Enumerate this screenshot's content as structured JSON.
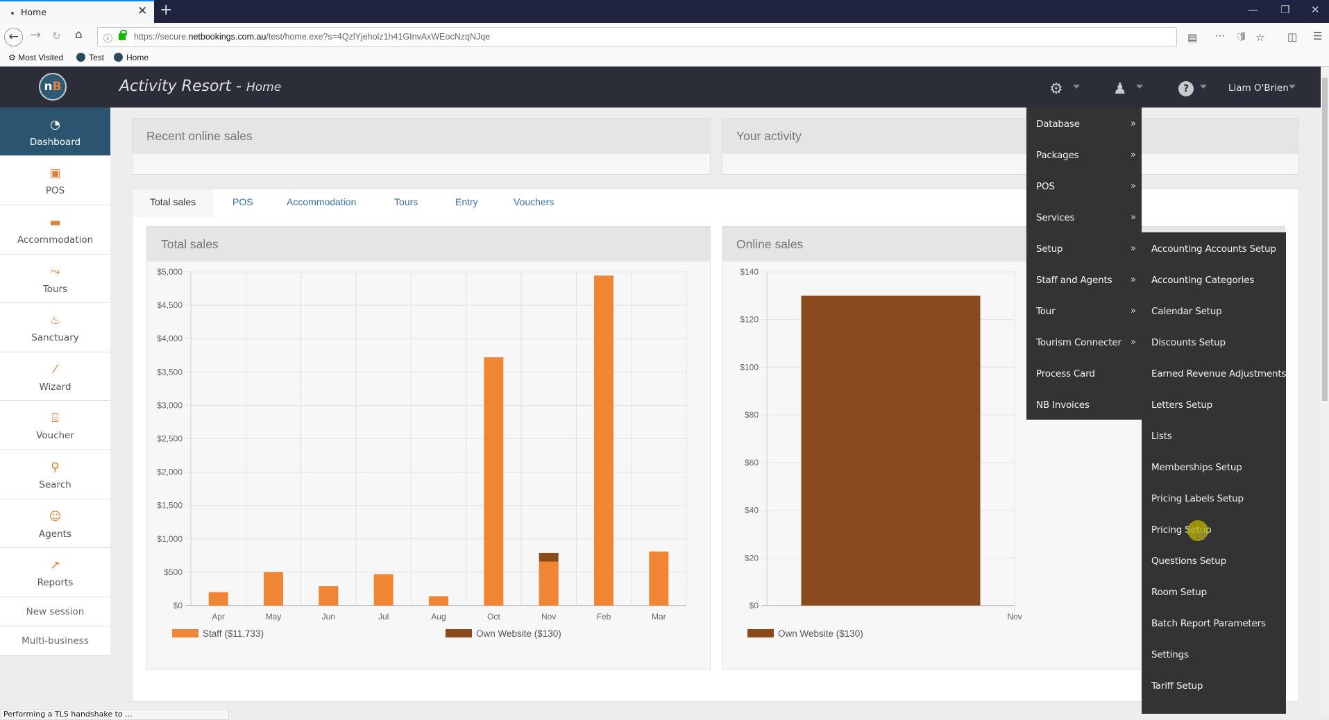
{
  "browser": {
    "tab_title": "Home",
    "url_prefix": "https://secure.",
    "url_domain": "netbookings.com.au",
    "url_path": "/test/home.exe?s=4QzlYjeholz1h41GInvAxWEocNzqNJqe",
    "bookmarks": [
      "Most Visited",
      "Test",
      "Home"
    ],
    "status_text": "Performing a TLS handshake to ..."
  },
  "header": {
    "app_name": "Activity Resort -",
    "page_name": "Home",
    "user_name": "Liam O'Brien",
    "logo_text": "n",
    "logo_accent": "B"
  },
  "sidebar": {
    "items": [
      {
        "label": "Dashboard",
        "icon": "dashboard-icon",
        "glyph": "◔"
      },
      {
        "label": "POS",
        "icon": "pos-icon",
        "glyph": "▣"
      },
      {
        "label": "Accommodation",
        "icon": "bed-icon",
        "glyph": "▬"
      },
      {
        "label": "Tours",
        "icon": "tours-icon",
        "glyph": "⤳"
      },
      {
        "label": "Sanctuary",
        "icon": "sanctuary-icon",
        "glyph": "♨"
      },
      {
        "label": "Wizard",
        "icon": "wand-icon",
        "glyph": "⁄"
      },
      {
        "label": "Voucher",
        "icon": "gift-icon",
        "glyph": "⌸"
      },
      {
        "label": "Search",
        "icon": "search-icon",
        "glyph": "⚲"
      },
      {
        "label": "Agents",
        "icon": "agent-icon",
        "glyph": "☺"
      },
      {
        "label": "Reports",
        "icon": "reports-icon",
        "glyph": "↗"
      }
    ],
    "plain_items": [
      "New session",
      "Multi-business"
    ]
  },
  "panels": {
    "recent_online_sales": "Recent online sales",
    "your_activity": "Your activity"
  },
  "tabs": [
    "Total sales",
    "POS",
    "Accommodation",
    "Tours",
    "Entry",
    "Vouchers"
  ],
  "colors": {
    "staff": "#f08533",
    "own_website": "#8b4a1e",
    "menu_bg": "#333333",
    "sidebar_active": "#2a5470"
  },
  "chart_data": [
    {
      "type": "bar",
      "title": "Total sales",
      "stacked": true,
      "categories": [
        "Apr",
        "May",
        "Jun",
        "Jul",
        "Aug",
        "Oct",
        "Nov",
        "Feb",
        "Mar"
      ],
      "series": [
        {
          "name": "Staff ($11,733)",
          "values": [
            200,
            500,
            290,
            470,
            140,
            3720,
            660,
            4945,
            808
          ]
        },
        {
          "name": "Own Website ($130)",
          "values": [
            0,
            0,
            0,
            0,
            0,
            0,
            130,
            0,
            0
          ]
        }
      ],
      "ylim": [
        0,
        5000
      ],
      "yticks": [
        0,
        500,
        1000,
        1500,
        2000,
        2500,
        3000,
        3500,
        4000,
        4500,
        5000
      ],
      "ytick_labels": [
        "$0",
        "$500",
        "$1,000",
        "$1,500",
        "$2,000",
        "$2,500",
        "$3,000",
        "$3,500",
        "$4,000",
        "$4,500",
        "$5,000"
      ],
      "xlabel": "",
      "ylabel": "",
      "grid": true,
      "legend": "bottom"
    },
    {
      "type": "bar",
      "title": "Online sales",
      "categories": [
        "Nov"
      ],
      "series": [
        {
          "name": "Own Website ($130)",
          "values": [
            130
          ]
        }
      ],
      "ylim": [
        0,
        140
      ],
      "yticks": [
        0,
        20,
        40,
        60,
        80,
        100,
        120,
        140
      ],
      "ytick_labels": [
        "$0",
        "$20",
        "$40",
        "$60",
        "$80",
        "$100",
        "$120",
        "$140"
      ],
      "xlabel": "",
      "ylabel": "",
      "grid": true,
      "legend": "bottom"
    }
  ],
  "menu": {
    "items": [
      {
        "label": "Database",
        "submenu": "»"
      },
      {
        "label": "Packages",
        "submenu": "»"
      },
      {
        "label": "POS",
        "submenu": "»"
      },
      {
        "label": "Services",
        "submenu": "»"
      },
      {
        "label": "Setup",
        "submenu": "»"
      },
      {
        "label": "Staff and Agents",
        "submenu": "»"
      },
      {
        "label": "Tour",
        "submenu": "»"
      },
      {
        "label": "Tourism Connecter",
        "submenu": "»"
      },
      {
        "label": "Process Card",
        "submenu": ""
      },
      {
        "label": "NB Invoices",
        "submenu": ""
      }
    ],
    "setup_submenu": [
      "Accounting Accounts Setup",
      "Accounting Categories",
      "Calendar Setup",
      "Discounts Setup",
      "Earned Revenue Adjustments",
      "Letters Setup",
      "Lists",
      "Memberships Setup",
      "Pricing Labels Setup",
      "Pricing Setup",
      "Questions Setup",
      "Room Setup",
      "Batch Report Parameters",
      "Settings",
      "Tariff Setup"
    ],
    "hovered": "Pricing Setup"
  }
}
